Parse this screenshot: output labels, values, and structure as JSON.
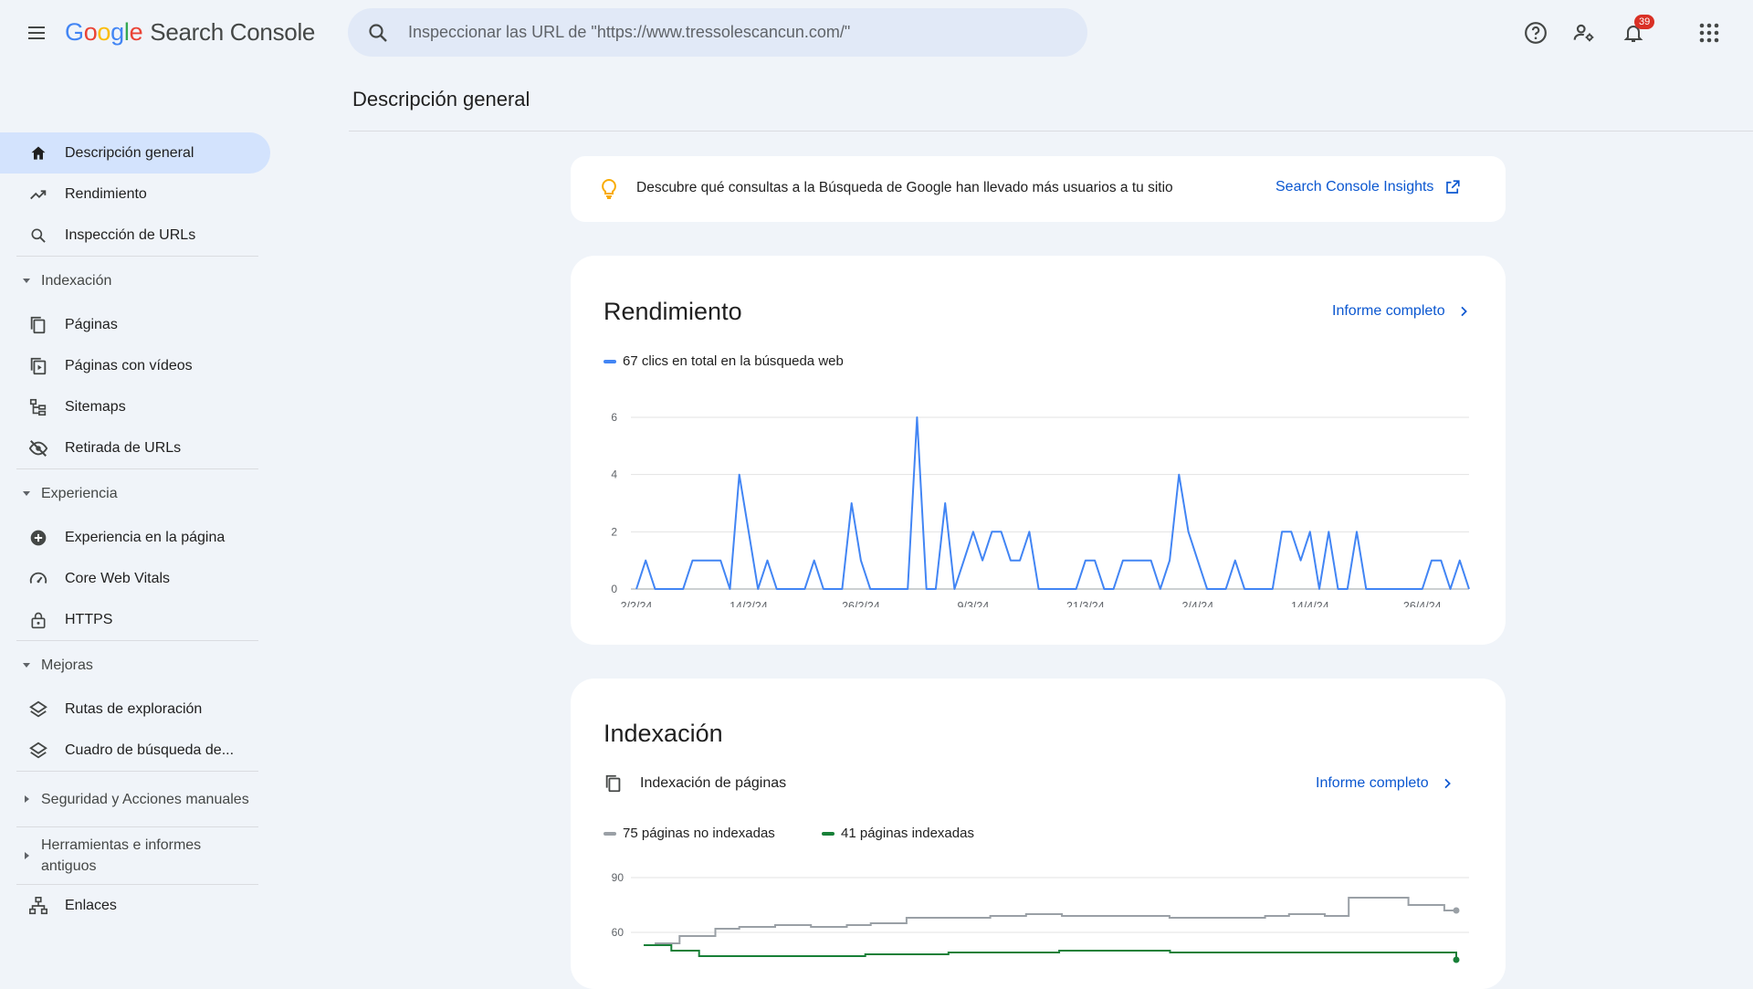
{
  "header": {
    "logo_google": [
      "G",
      "o",
      "o",
      "g",
      "l",
      "e"
    ],
    "product": "Search Console",
    "search_placeholder": "Inspeccionar las URL de \"https://www.tressolescancun.com/\"",
    "notifications_count": "39"
  },
  "colors": {
    "accent": "#0b57d0",
    "clicks": "#4285f4",
    "not_indexed": "#9aa0a6",
    "indexed": "#188038",
    "active_nav": "#d3e3fd"
  },
  "sidebar": {
    "top_items": [
      {
        "label": "Descripción general",
        "icon": "home-icon"
      },
      {
        "label": "Rendimiento",
        "icon": "trending-up-icon"
      },
      {
        "label": "Inspección de URLs",
        "icon": "search-icon"
      }
    ],
    "indexacion": {
      "label": "Indexación",
      "items": [
        {
          "label": "Páginas",
          "icon": "pages-icon"
        },
        {
          "label": "Páginas con vídeos",
          "icon": "video-pages-icon"
        },
        {
          "label": "Sitemaps",
          "icon": "sitemap-icon"
        },
        {
          "label": "Retirada de URLs",
          "icon": "eye-off-icon"
        }
      ]
    },
    "experiencia": {
      "label": "Experiencia",
      "items": [
        {
          "label": "Experiencia en la página",
          "icon": "plus-circle-icon"
        },
        {
          "label": "Core Web Vitals",
          "icon": "gauge-icon"
        },
        {
          "label": "HTTPS",
          "icon": "lock-icon"
        }
      ]
    },
    "mejoras": {
      "label": "Mejoras",
      "items": [
        {
          "label": "Rutas de exploración",
          "icon": "layers-icon"
        },
        {
          "label": "Cuadro de búsqueda de...",
          "icon": "layers-icon"
        }
      ]
    },
    "seguridad": "Seguridad y Acciones manuales",
    "herramientas_1": "Herramientas e informes",
    "herramientas_2": "antiguos",
    "enlaces": "Enlaces"
  },
  "main": {
    "title": "Descripción general",
    "insights": {
      "text": "Descubre qué consultas a la Búsqueda de Google han llevado más usuarios a tu sitio",
      "link": "Search Console Insights"
    },
    "performance": {
      "title": "Rendimiento",
      "link": "Informe completo",
      "legend": "67 clics en total en la búsqueda web"
    },
    "indexing": {
      "title": "Indexación",
      "subtitle": "Indexación de páginas",
      "link": "Informe completo",
      "legend_not_indexed": "75 páginas no indexadas",
      "legend_indexed": "41 páginas indexadas"
    }
  },
  "chart_data": [
    {
      "type": "line",
      "series": [
        {
          "name": "clics",
          "values": [
            0,
            1,
            0,
            0,
            0,
            0,
            1,
            1,
            1,
            1,
            0,
            4,
            2,
            0,
            1,
            0,
            0,
            0,
            0,
            1,
            0,
            0,
            0,
            3,
            1,
            0,
            0,
            0,
            0,
            0,
            6,
            0,
            0,
            3,
            0,
            1,
            2,
            1,
            2,
            2,
            1,
            1,
            2,
            0,
            0,
            0,
            0,
            0,
            1,
            1,
            0,
            0,
            1,
            1,
            1,
            1,
            0,
            1,
            4,
            2,
            1,
            0,
            0,
            0,
            1,
            0,
            0,
            0,
            0,
            2,
            2,
            1,
            2,
            0,
            2,
            0,
            0,
            2,
            0,
            0,
            0,
            0,
            0,
            0,
            0,
            1,
            1,
            0,
            1,
            0
          ]
        }
      ],
      "x_tick_labels": [
        "2/2/24",
        "14/2/24",
        "26/2/24",
        "9/3/24",
        "21/3/24",
        "2/4/24",
        "14/4/24",
        "26/4/24"
      ],
      "x_tick_index": [
        0,
        12,
        24,
        36,
        48,
        60,
        72,
        84
      ],
      "y_ticks": [
        0,
        2,
        4,
        6
      ],
      "ylim": [
        0,
        6
      ]
    },
    {
      "type": "line",
      "series": [
        {
          "name": "no indexadas",
          "values": [
            53,
            54,
            54,
            58,
            58,
            58,
            62,
            62,
            63,
            63,
            63,
            64,
            64,
            64,
            63,
            63,
            63,
            64,
            64,
            65,
            65,
            65,
            68,
            68,
            68,
            68,
            68,
            68,
            68,
            69,
            69,
            69,
            70,
            70,
            70,
            69,
            69,
            69,
            69,
            69,
            69,
            69,
            69,
            69,
            68,
            68,
            68,
            68,
            68,
            68,
            68,
            68,
            69,
            69,
            70,
            70,
            70,
            69,
            69,
            79,
            79,
            79,
            79,
            79,
            75,
            75,
            75,
            72,
            72
          ]
        },
        {
          "name": "indexadas",
          "values": [
            53,
            53,
            53,
            50,
            50,
            50,
            47,
            47,
            47,
            47,
            47,
            47,
            47,
            47,
            47,
            47,
            47,
            47,
            47,
            47,
            47,
            47,
            47,
            47,
            48,
            48,
            48,
            48,
            48,
            48,
            48,
            48,
            48,
            49,
            49,
            49,
            49,
            49,
            49,
            49,
            49,
            49,
            49,
            49,
            49,
            50,
            50,
            50,
            50,
            50,
            50,
            50,
            50,
            50,
            50,
            50,
            50,
            49,
            49,
            49,
            49,
            49,
            49,
            49,
            49,
            49,
            49,
            49,
            49,
            49,
            49,
            49,
            49,
            49,
            49,
            49,
            49,
            49,
            49,
            49,
            49,
            49,
            49,
            49,
            49,
            49,
            49,
            49,
            45
          ]
        }
      ],
      "y_ticks": [
        60,
        90
      ],
      "ylim": [
        30,
        90
      ]
    }
  ]
}
